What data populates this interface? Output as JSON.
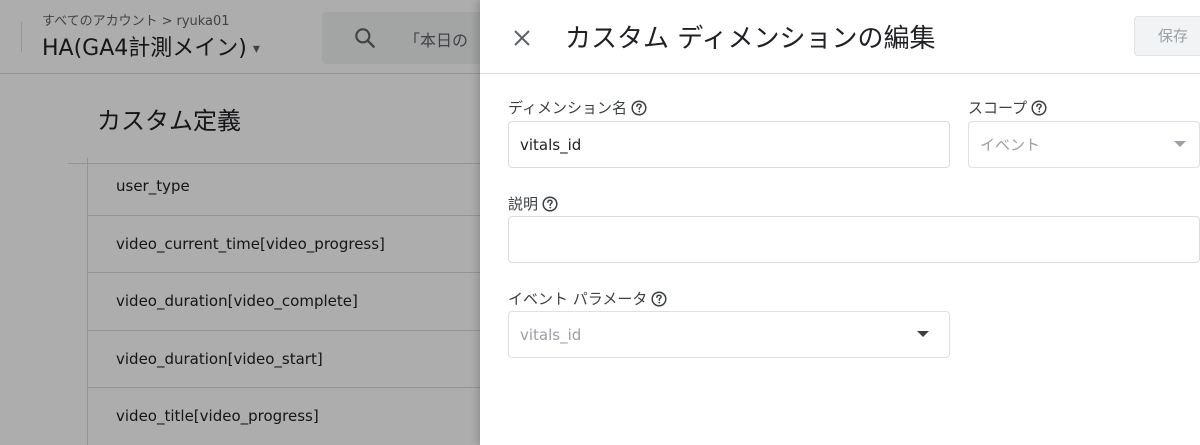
{
  "header": {
    "breadcrumb_root": "すべてのアカウント",
    "breadcrumb_separator": ">",
    "breadcrumb_account": "ryuka01",
    "property_name": "HA(GA4計測メイン)",
    "search_placeholder": "「本日の"
  },
  "section": {
    "title": "カスタム定義"
  },
  "dimension_list": [
    "user_type",
    "video_current_time[video_progress]",
    "video_duration[video_complete]",
    "video_duration[video_start]",
    "video_title[video_progress]"
  ],
  "panel": {
    "title": "カスタム ディメンションの編集",
    "save_label": "保存",
    "dimension_name_label": "ディメンション名",
    "dimension_name_value": "vitals_id",
    "scope_label": "スコープ",
    "scope_value": "イベント",
    "description_label": "説明",
    "description_value": "",
    "event_parameter_label": "イベント パラメータ",
    "event_parameter_value": "vitals_id"
  },
  "icons": {
    "search": "search-icon",
    "close": "close-icon",
    "help": "help-circle-icon",
    "dropdown": "dropdown-arrow-icon"
  },
  "colors": {
    "scrim": "#000000",
    "text_primary": "#202124",
    "text_disabled": "#9aa0a6",
    "border": "#dadce0"
  }
}
